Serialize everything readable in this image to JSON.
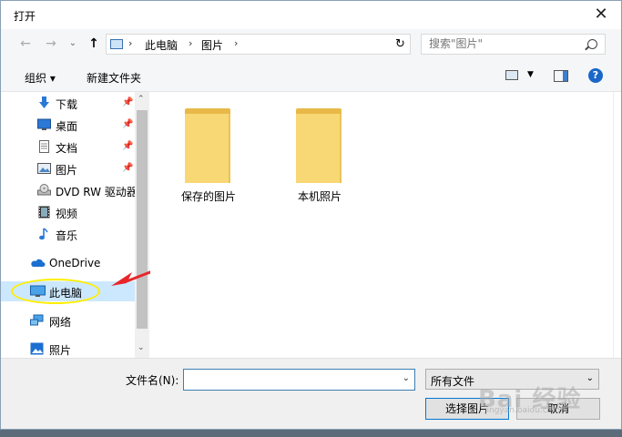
{
  "window": {
    "title": "打开"
  },
  "nav": {
    "back": "←",
    "forward": "→",
    "recent": "⌄",
    "up": "↑",
    "breadcrumb": [
      "此电脑",
      "图片"
    ],
    "search_placeholder": "搜索\"图片\""
  },
  "toolbar": {
    "organize": "组织 ▾",
    "new_folder": "新建文件夹",
    "help": "?"
  },
  "sidebar": {
    "items": [
      {
        "label": "下载",
        "icon": "download-icon",
        "pinned": true
      },
      {
        "label": "桌面",
        "icon": "desktop-icon",
        "pinned": true
      },
      {
        "label": "文档",
        "icon": "document-icon",
        "pinned": true
      },
      {
        "label": "图片",
        "icon": "pictures-icon",
        "pinned": true
      },
      {
        "label": "DVD RW 驱动器",
        "icon": "dvd-drive-icon",
        "pinned": false
      },
      {
        "label": "视频",
        "icon": "video-icon",
        "pinned": false
      },
      {
        "label": "音乐",
        "icon": "music-icon",
        "pinned": false
      },
      {
        "label": "OneDrive",
        "icon": "onedrive-icon",
        "pinned": false
      },
      {
        "label": "此电脑",
        "icon": "computer-icon",
        "pinned": false,
        "selected": true
      },
      {
        "label": "网络",
        "icon": "network-icon",
        "pinned": false
      },
      {
        "label": "照片",
        "icon": "photos-icon",
        "pinned": false
      }
    ]
  },
  "folders": [
    "保存的图片",
    "本机照片"
  ],
  "bottom": {
    "filename_label": "文件名(N):",
    "filename_value": "",
    "filter_value": "所有文件",
    "open_button": "选择图片",
    "cancel_button": "取消"
  },
  "colors": {
    "accent": "#0078d7",
    "highlight": "#ffee00",
    "arrow": "#e8262a",
    "folder": "#f8d775"
  },
  "watermark": {
    "text": "Bai 经验",
    "sub": "jingyan.baidu.com"
  }
}
